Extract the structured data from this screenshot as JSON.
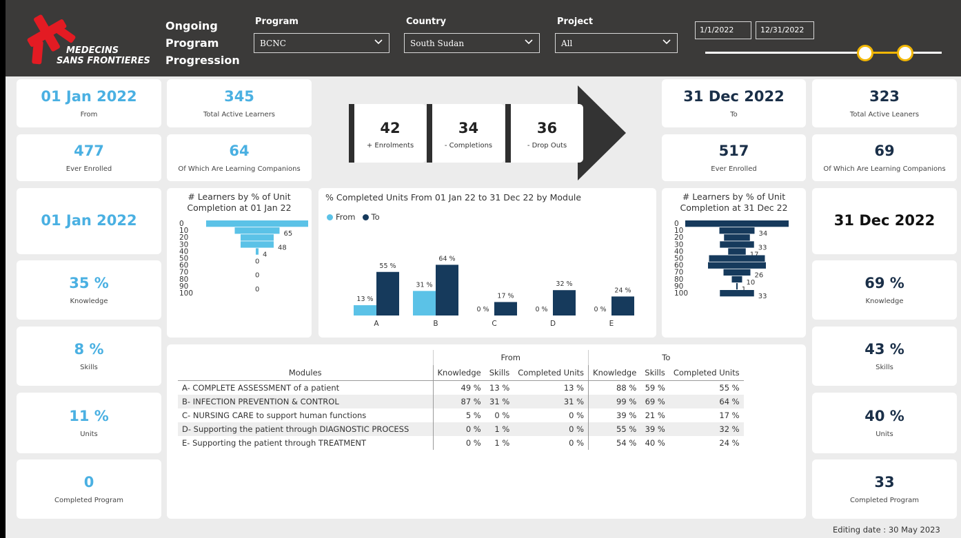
{
  "logo": {
    "line1": "MEDECINS",
    "line2": "SANS FRONTIERES"
  },
  "header": {
    "title": "Ongoing Program Progression"
  },
  "filters": {
    "program": {
      "label": "Program",
      "value": "BCNC"
    },
    "country": {
      "label": "Country",
      "value": "South Sudan"
    },
    "project": {
      "label": "Project",
      "value": "All"
    },
    "date_from": "1/1/2022",
    "date_to": "12/31/2022"
  },
  "left": {
    "from_date": {
      "value": "01 Jan 2022",
      "label": "From"
    },
    "total_active": {
      "value": "345",
      "label": "Total Active Learners"
    },
    "ever_enrolled": {
      "value": "477",
      "label": "Ever Enrolled"
    },
    "companions": {
      "value": "64",
      "label": "Of Which Are Learning Companions"
    },
    "date2": {
      "value": "01 Jan 2022"
    },
    "knowledge": {
      "value": "35 %",
      "label": "Knowledge"
    },
    "skills": {
      "value": "8 %",
      "label": "Skills"
    },
    "units": {
      "value": "11 %",
      "label": "Units"
    },
    "completed": {
      "value": "0",
      "label": "Completed Program"
    }
  },
  "right": {
    "to_date": {
      "value": "31 Dec 2022",
      "label": "To"
    },
    "total_active": {
      "value": "323",
      "label": "Total Active Leaners"
    },
    "ever_enrolled": {
      "value": "517",
      "label": "Ever Enrolled"
    },
    "companions": {
      "value": "69",
      "label": "Of Which Are Learning Companions"
    },
    "date2": {
      "value": "31 Dec 2022"
    },
    "knowledge": {
      "value": "69 %",
      "label": "Knowledge"
    },
    "skills": {
      "value": "43 %",
      "label": "Skills"
    },
    "units": {
      "value": "40 %",
      "label": "Units"
    },
    "completed": {
      "value": "33",
      "label": "Completed Program"
    }
  },
  "flow": [
    {
      "value": "42",
      "label": "+ Enrolments"
    },
    {
      "value": "34",
      "label": "- Completions"
    },
    {
      "value": "36",
      "label": "- Drop Outs"
    }
  ],
  "footer": {
    "editing_date": "Editing date :  30 May 2023"
  },
  "colors": {
    "from": "#5bc2e7",
    "to": "#163a5c",
    "header": "#3b3a39",
    "accent": "#f2b705",
    "logo": "#e31b23"
  },
  "chart_data": [
    {
      "type": "bar",
      "orientation": "horizontal",
      "title": "# Learners by % of Unit Completion at 01 Jan 22",
      "categories": [
        "0",
        "10",
        "20",
        "30",
        "40",
        "50",
        "60",
        "70",
        "80",
        "90",
        "100"
      ],
      "values": [
        148,
        65,
        48,
        48,
        4,
        0,
        0,
        0,
        0,
        0,
        0
      ],
      "data_labels": [
        "",
        "65",
        "",
        "48",
        "4",
        "0",
        "",
        "0",
        "",
        "0",
        ""
      ]
    },
    {
      "type": "bar",
      "title": "% Completed Units From 01 Jan 22 to 31 Dec 22 by Module",
      "legend": [
        "From",
        "To"
      ],
      "legend_position": "top-left",
      "categories": [
        "A",
        "B",
        "C",
        "D",
        "E"
      ],
      "series": [
        {
          "name": "From",
          "values": [
            13,
            31,
            0,
            0,
            0
          ],
          "labels": [
            "13 %",
            "31 %",
            "0 %",
            "0 %",
            "0 %"
          ]
        },
        {
          "name": "To",
          "values": [
            55,
            64,
            17,
            32,
            24
          ],
          "labels": [
            "55 %",
            "64 %",
            "17 %",
            "32 %",
            "24 %"
          ]
        }
      ]
    },
    {
      "type": "bar",
      "orientation": "horizontal",
      "title": "# Learners by % of Unit Completion at 31 Dec 22",
      "categories": [
        "0",
        "10",
        "20",
        "30",
        "40",
        "50",
        "60",
        "70",
        "80",
        "90",
        "100"
      ],
      "values": [
        100,
        34,
        25,
        33,
        17,
        54,
        56,
        26,
        10,
        1,
        33
      ],
      "data_labels": [
        "",
        "34",
        "",
        "33",
        "17",
        "",
        "",
        "26",
        "10",
        "1",
        "33"
      ]
    }
  ],
  "table": {
    "group_from": "From",
    "group_to": "To",
    "headers": [
      "Modules",
      "Knowledge",
      "Skills",
      "Completed Units",
      "Knowledge",
      "Skills",
      "Completed Units"
    ],
    "rows": [
      [
        "A- COMPLETE ASSESSMENT of a patient",
        "49 %",
        "13 %",
        "13 %",
        "88 %",
        "59 %",
        "55 %"
      ],
      [
        "B- INFECTION PREVENTION & CONTROL",
        "87 %",
        "31 %",
        "31 %",
        "99 %",
        "69 %",
        "64 %"
      ],
      [
        "C- NURSING CARE to support human functions",
        "5 %",
        "0 %",
        "0 %",
        "39 %",
        "21 %",
        "17 %"
      ],
      [
        "D- Supporting the patient through DIAGNOSTIC PROCESS",
        "0 %",
        "1 %",
        "0 %",
        "55 %",
        "39 %",
        "32 %"
      ],
      [
        "E- Supporting the patient through TREATMENT",
        "0 %",
        "1 %",
        "0 %",
        "54 %",
        "40 %",
        "24 %"
      ]
    ]
  }
}
